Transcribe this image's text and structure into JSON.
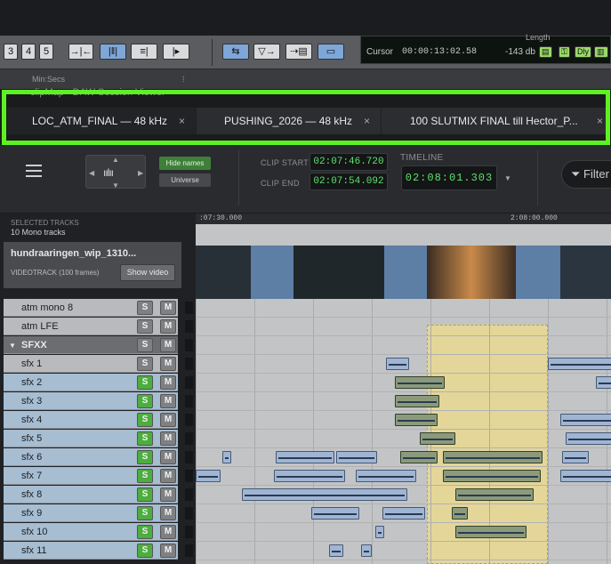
{
  "host": {
    "toolbar_buttons": [
      "3",
      "4",
      "5"
    ],
    "counter": {
      "cursor_label": "Cursor",
      "cursor_value": "00:00:13:02.58",
      "level": "-143 db",
      "dly": "Dly",
      "length_label": "Length"
    },
    "ruler_text": "Min:Secs",
    "window_title": "clipMap - DAW Session Viewer"
  },
  "tabs": [
    {
      "label": "LOC_ATM_FINAL — 48 kHz",
      "close": "×"
    },
    {
      "label": "PUSHING_2026 — 48 kHz",
      "close": "×"
    },
    {
      "label": "100 SLUTMIX FINAL till Hector_P...",
      "close": "×"
    }
  ],
  "header": {
    "hide_names": "Hide names",
    "universe": "Universe",
    "clip_start_label": "CLIP START",
    "clip_start": "02:07:46.720",
    "clip_end_label": "CLIP END",
    "clip_end": "02:07:54.092",
    "timeline_label": "TIMELINE",
    "timeline": "02:08:01.303",
    "filter": "Filter"
  },
  "left": {
    "selected_label": "SELECTED TRACKS",
    "selected_count": "10 Mono tracks",
    "video_name": "hundraaringen_wip_1310...",
    "video_kind": "VIDEOTRACK",
    "video_frames": "(100 frames)",
    "show_video": "Show video"
  },
  "ruler": {
    "left": ":07:30.000",
    "right": "2:08:00.000"
  },
  "tracks": [
    {
      "name": "atm mono 8",
      "solo": "S",
      "mute": "M",
      "solo_on": false,
      "selected": false,
      "folder": false
    },
    {
      "name": "atm LFE",
      "solo": "S",
      "mute": "M",
      "solo_on": false,
      "selected": false,
      "folder": false
    },
    {
      "name": "SFXX",
      "solo": "S",
      "mute": "M",
      "solo_on": false,
      "selected": false,
      "folder": true
    },
    {
      "name": "sfx 1",
      "solo": "S",
      "mute": "M",
      "solo_on": false,
      "selected": false,
      "folder": false
    },
    {
      "name": "sfx 2",
      "solo": "S",
      "mute": "M",
      "solo_on": true,
      "selected": true,
      "folder": false
    },
    {
      "name": "sfx 3",
      "solo": "S",
      "mute": "M",
      "solo_on": true,
      "selected": true,
      "folder": false
    },
    {
      "name": "sfx 4",
      "solo": "S",
      "mute": "M",
      "solo_on": true,
      "selected": true,
      "folder": false
    },
    {
      "name": "sfx 5",
      "solo": "S",
      "mute": "M",
      "solo_on": true,
      "selected": true,
      "folder": false
    },
    {
      "name": "sfx 6",
      "solo": "S",
      "mute": "M",
      "solo_on": true,
      "selected": true,
      "folder": false
    },
    {
      "name": "sfx 7",
      "solo": "S",
      "mute": "M",
      "solo_on": true,
      "selected": true,
      "folder": false
    },
    {
      "name": "sfx 8",
      "solo": "S",
      "mute": "M",
      "solo_on": true,
      "selected": true,
      "folder": false
    },
    {
      "name": "sfx 9",
      "solo": "S",
      "mute": "M",
      "solo_on": true,
      "selected": true,
      "folder": false
    },
    {
      "name": "sfx 10",
      "solo": "S",
      "mute": "M",
      "solo_on": true,
      "selected": true,
      "folder": false
    },
    {
      "name": "sfx 11",
      "solo": "S",
      "mute": "M",
      "solo_on": true,
      "selected": true,
      "folder": false
    }
  ],
  "colors": {
    "highlight": "#5cf221",
    "solo_on": "#4cae3e",
    "timecode": "#5ce36b",
    "selection": "#efdc8a"
  }
}
